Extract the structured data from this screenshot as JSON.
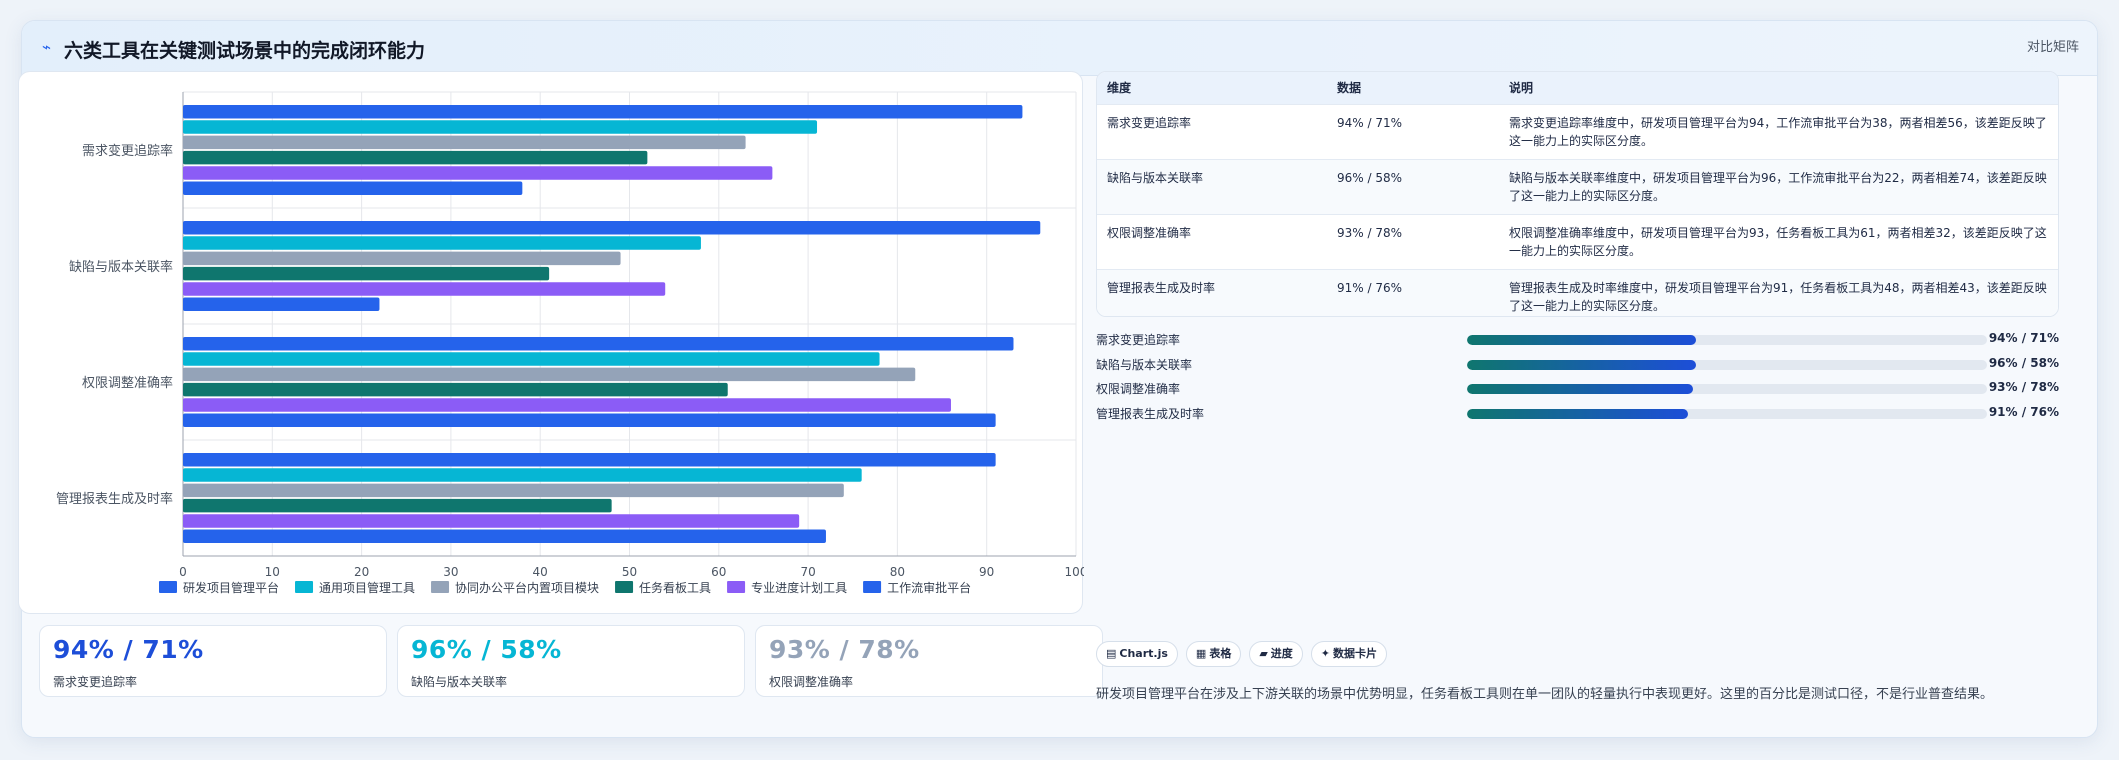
{
  "header": {
    "icon": "trend-line-icon",
    "title": "六类工具在关键测试场景中的完成闭环能力",
    "badge": "对比矩阵"
  },
  "chart_data": {
    "type": "bar",
    "orientation": "horizontal",
    "categories": [
      "需求变更追踪率",
      "缺陷与版本关联率",
      "权限调整准确率",
      "管理报表生成及时率"
    ],
    "series": [
      {
        "name": "研发项目管理平台",
        "color": "#2563eb",
        "values": [
          94,
          96,
          93,
          91
        ]
      },
      {
        "name": "通用项目管理工具",
        "color": "#06b6d4",
        "values": [
          71,
          58,
          78,
          76
        ]
      },
      {
        "name": "协同办公平台内置项目模块",
        "color": "#94a3b8",
        "values": [
          63,
          49,
          82,
          74
        ]
      },
      {
        "name": "任务看板工具",
        "color": "#0f766e",
        "values": [
          52,
          41,
          61,
          48
        ]
      },
      {
        "name": "专业进度计划工具",
        "color": "#8b5cf6",
        "values": [
          66,
          54,
          86,
          69
        ]
      },
      {
        "name": "工作流审批平台",
        "color": "#2563eb",
        "values": [
          38,
          22,
          91,
          72
        ]
      }
    ],
    "x_ticks": [
      "0",
      "10",
      "20",
      "30",
      "40",
      "50",
      "60",
      "70",
      "80",
      "90",
      "100"
    ],
    "xlim": [
      0,
      100
    ],
    "grid": true,
    "legend_position": "bottom"
  },
  "table": {
    "headers": [
      "维度",
      "数据",
      "说明"
    ],
    "rows": [
      {
        "dim": "需求变更追踪率",
        "val": "94% / 71%",
        "desc": "需求变更追踪率维度中，研发项目管理平台为94，工作流审批平台为38，两者相差56，该差距反映了这一能力上的实际区分度。"
      },
      {
        "dim": "缺陷与版本关联率",
        "val": "96% / 58%",
        "desc": "缺陷与版本关联率维度中，研发项目管理平台为96，工作流审批平台为22，两者相差74，该差距反映了这一能力上的实际区分度。"
      },
      {
        "dim": "权限调整准确率",
        "val": "93% / 78%",
        "desc": "权限调整准确率维度中，研发项目管理平台为93，任务看板工具为61，两者相差32，该差距反映了这一能力上的实际区分度。"
      },
      {
        "dim": "管理报表生成及时率",
        "val": "91% / 76%",
        "desc": "管理报表生成及时率维度中，研发项目管理平台为91，任务看板工具为48，两者相差43，该差距反映了这一能力上的实际区分度。"
      }
    ]
  },
  "progress": [
    {
      "label": "需求变更追踪率",
      "value": "94% / 71%",
      "fill_percent": 44
    },
    {
      "label": "缺陷与版本关联率",
      "value": "96% / 58%",
      "fill_percent": 44
    },
    {
      "label": "权限调整准确率",
      "value": "93% / 78%",
      "fill_percent": 43.5
    },
    {
      "label": "管理报表生成及时率",
      "value": "91% / 76%",
      "fill_percent": 42.5
    }
  ],
  "stats": [
    {
      "value": "94% / 71%",
      "label": "需求变更追踪率",
      "color": "#1d4ed8"
    },
    {
      "value": "96% / 58%",
      "label": "缺陷与版本关联率",
      "color": "#06b6d4"
    },
    {
      "value": "93% / 78%",
      "label": "权限调整准确率",
      "color": "#94a3b8"
    }
  ],
  "tags": [
    {
      "icon": "chart-icon",
      "glyph": "▤",
      "label": "Chart.js"
    },
    {
      "icon": "table-icon",
      "glyph": "▦",
      "label": "表格"
    },
    {
      "icon": "progress-icon",
      "glyph": "▰",
      "label": "进度"
    },
    {
      "icon": "card-icon",
      "glyph": "✦",
      "label": "数据卡片"
    }
  ],
  "footnote": "研发项目管理平台在涉及上下游关联的场景中优势明显，任务看板工具则在单一团队的轻量执行中表现更好。这里的百分比是测试口径，不是行业普查结果。"
}
